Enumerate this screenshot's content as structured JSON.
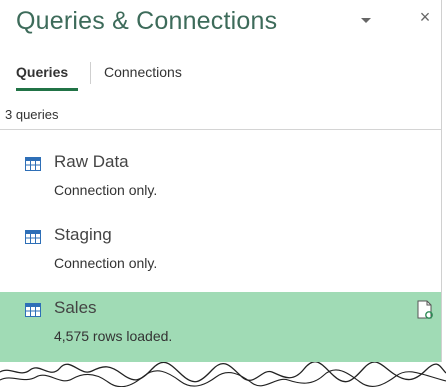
{
  "pane": {
    "title": "Queries & Connections",
    "close_glyph": "×",
    "dropdown_icon": "chevron-down-icon"
  },
  "tabs": [
    {
      "label": "Queries",
      "active": true
    },
    {
      "label": "Connections",
      "active": false
    }
  ],
  "query_count": "3 queries",
  "queries": [
    {
      "name": "Raw Data",
      "status": "Connection only.",
      "icon": "table-icon",
      "selected": false
    },
    {
      "name": "Staging",
      "status": "Connection only.",
      "icon": "table-icon",
      "selected": false
    },
    {
      "name": "Sales",
      "status": "4,575 rows loaded.",
      "icon": "table-icon",
      "selected": true,
      "action_icon": "refresh-document-icon"
    }
  ],
  "colors": {
    "title": "#3d6b5a",
    "accent": "#217346",
    "selected_row": "#a0dbb5",
    "table_icon": "#2e6fb7"
  }
}
